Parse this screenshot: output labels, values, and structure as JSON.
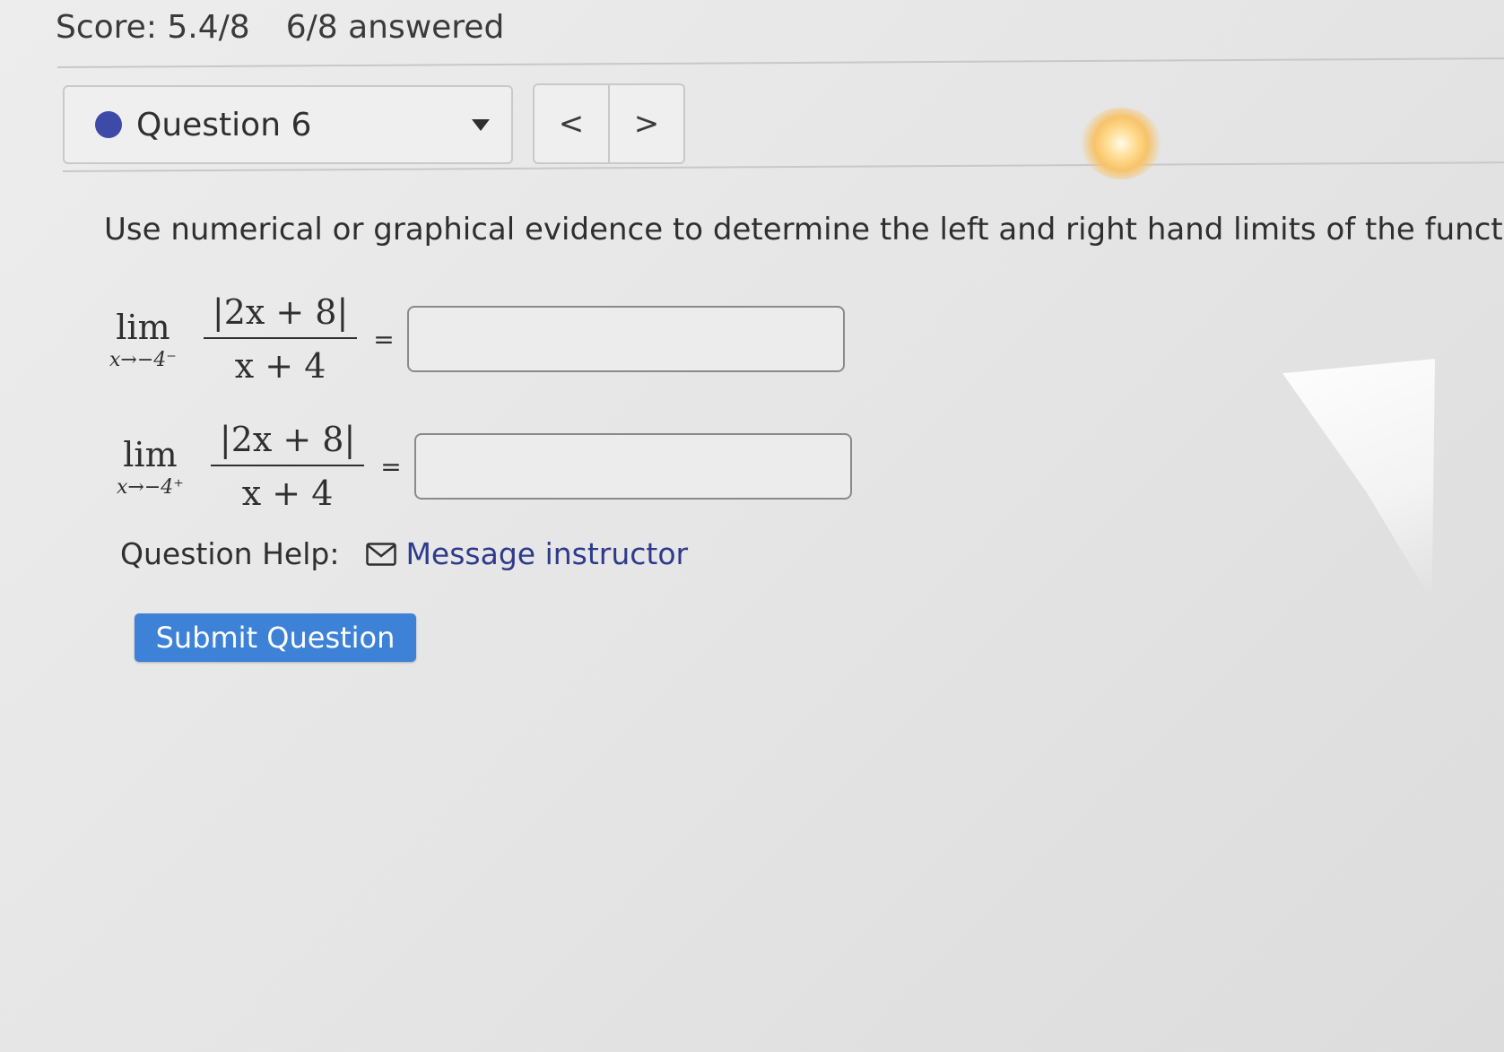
{
  "score": {
    "label": "Score: 5.4/8",
    "answered": "6/8 answered"
  },
  "question_nav": {
    "selected": "Question 6",
    "status_color": "#3d4aa8",
    "prev_label": "<",
    "next_label": ">"
  },
  "question": {
    "prompt": "Use numerical or graphical evidence to determine the left and right hand limits of the function.",
    "limits": [
      {
        "lim_word": "lim",
        "subscript": "x→−4⁻",
        "numerator": "|2x + 8|",
        "denominator": "x + 4",
        "equals": "=",
        "answer_value": ""
      },
      {
        "lim_word": "lim",
        "subscript": "x→−4⁺",
        "numerator": "|2x + 8|",
        "denominator": "x + 4",
        "equals": "=",
        "answer_value": ""
      }
    ]
  },
  "help": {
    "label": "Question Help:",
    "icon": "envelope-icon",
    "link_text": "Message instructor"
  },
  "submit": {
    "label": "Submit Question",
    "color": "#3e82d8"
  }
}
